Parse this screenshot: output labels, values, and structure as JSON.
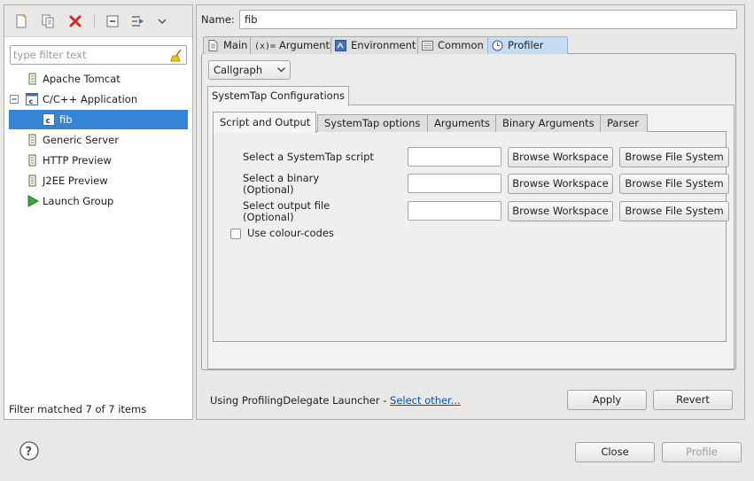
{
  "left": {
    "filter_placeholder": "type filter text",
    "tree": [
      {
        "label": "Apache Tomcat",
        "icon": "server-icon"
      },
      {
        "label": "C/C++ Application",
        "icon": "c-app-icon",
        "expanded": true
      },
      {
        "label": "fib",
        "icon": "c-file-icon",
        "selected": true
      },
      {
        "label": "Generic Server",
        "icon": "server-icon"
      },
      {
        "label": "HTTP Preview",
        "icon": "server-icon"
      },
      {
        "label": "J2EE Preview",
        "icon": "server-icon"
      },
      {
        "label": "Launch Group",
        "icon": "launch-group-icon"
      }
    ],
    "status": "Filter matched 7 of 7 items"
  },
  "right": {
    "name_label": "Name:",
    "name_value": "fib",
    "tabs": [
      {
        "label": "Main",
        "icon": "main-tab-icon"
      },
      {
        "label": "Arguments",
        "icon": "arguments-icon"
      },
      {
        "label": "Environment",
        "icon": "environment-icon"
      },
      {
        "label": "Common",
        "icon": "common-icon"
      },
      {
        "label": "Profiler",
        "icon": "profiler-icon",
        "selected": true
      }
    ],
    "profiler_type": "Callgraph",
    "config_tab": "SystemTap Configurations",
    "sub_tabs": [
      "Script and Output",
      "SystemTap options",
      "Arguments",
      "Binary Arguments",
      "Parser"
    ],
    "rows": [
      {
        "label": "Select a SystemTap script",
        "value": ""
      },
      {
        "label": "Select a binary\n(Optional)",
        "value": ""
      },
      {
        "label": "Select output file\n(Optional)",
        "value": ""
      }
    ],
    "browse_workspace": "Browse Workspace",
    "browse_file_system": "Browse File System",
    "colour_codes": "Use colour-codes",
    "launcher_prefix": "Using ProfilingDelegate Launcher - ",
    "launcher_link": "Select other...",
    "apply": "Apply",
    "revert": "Revert"
  },
  "footer": {
    "close": "Close",
    "profile": "Profile"
  },
  "colors": {
    "selection": "#3584d6",
    "active_tab": "#c6dcf3",
    "link": "#0b4fbb"
  }
}
